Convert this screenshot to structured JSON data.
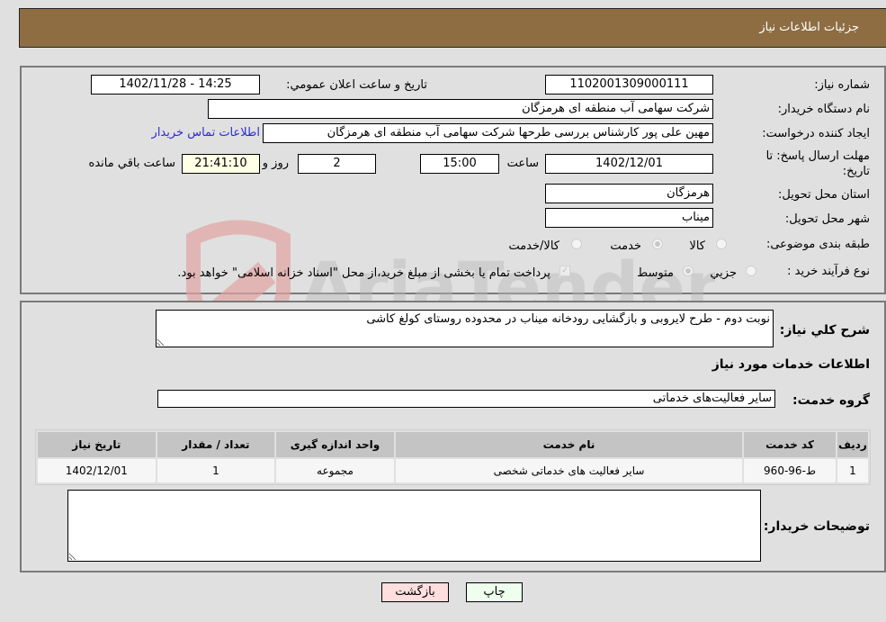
{
  "header": {
    "title": "جزئیات اطلاعات نیاز"
  },
  "details": {
    "need_number": {
      "label": "شماره نیاز:",
      "value": "1102001309000111"
    },
    "announce_datetime": {
      "label": "تاریخ و ساعت اعلان عمومي:",
      "value": "1402/11/28 - 14:25"
    },
    "buyer_org": {
      "label": "نام دستگاه خریدار:",
      "value": "شرکت سهامی  آب منطقه ای هرمزگان"
    },
    "requester": {
      "label": "ایجاد کننده درخواست:",
      "value": "مهین علی پور کارشناس بررسی طرحها شرکت سهامی  آب منطقه ای هرمزگان"
    },
    "buyer_contact_link": "اطلاعات تماس خریدار",
    "deadline": {
      "label_line1": "مهلت ارسال پاسخ: تا",
      "label_line2": "تاریخ:",
      "date": "1402/12/01",
      "time_label": "ساعت",
      "time": "15:00",
      "days": "2",
      "days_label": "روز و",
      "remaining": "21:41:10",
      "remaining_label": "ساعت باقي مانده"
    },
    "province": {
      "label": "استان محل تحویل:",
      "value": "هرمزگان"
    },
    "city": {
      "label": "شهر محل تحویل:",
      "value": "میناب"
    },
    "category": {
      "label": "طبقه بندی موضوعی:",
      "options": [
        "کالا",
        "خدمت",
        "کالا/خدمت"
      ],
      "selected": "خدمت"
    },
    "purchase_type": {
      "label": "نوع فرآیند خرید :",
      "options": [
        "جزيي",
        "متوسط"
      ],
      "selected": "متوسط",
      "treasury_note": "پرداخت تمام یا بخشی از مبلغ خرید،از محل \"اسناد خزانه اسلامی\" خواهد بود.",
      "treasury_checked": true
    }
  },
  "description": {
    "label": "شرح كلي نياز:",
    "value": "نوبت دوم - طرح لایروبی و بازگشایی رودخانه میناب در محدوده روستای کولغ کاشی"
  },
  "services": {
    "section_title": "اطلاعات خدمات مورد نياز",
    "group_label": "گروه خدمت:",
    "group_value": "سایر فعالیت‌های خدماتی",
    "columns": [
      "رديف",
      "کد خدمت",
      "نام خدمت",
      "واحد اندازه گیری",
      "تعداد / مقدار",
      "تاریخ نیاز"
    ],
    "rows": [
      [
        "1",
        "ط-96-960",
        "سایر فعالیت های خدماتی شخصی",
        "مجموعه",
        "1",
        "1402/12/01"
      ]
    ]
  },
  "buyer_notes": {
    "label": "توضیحات خریدار:",
    "value": ""
  },
  "buttons": {
    "print": "چاپ",
    "back": "بازگشت"
  },
  "watermark": {
    "text": "AriaTender.neT"
  }
}
